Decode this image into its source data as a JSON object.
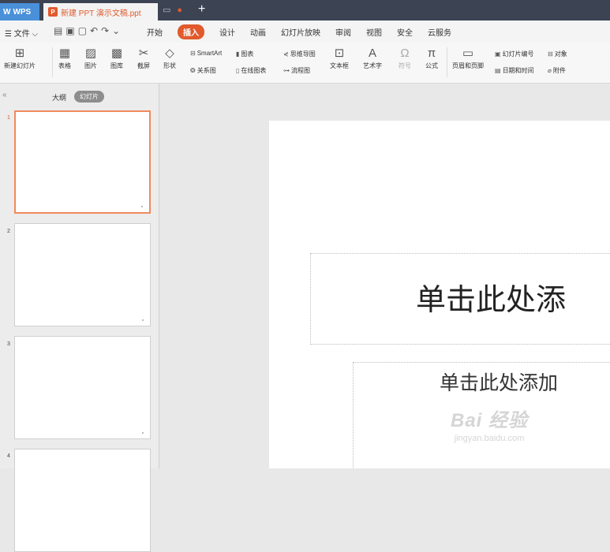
{
  "titlebar": {
    "app_tab": "WPS",
    "doc_tab": "新建 PPT 演示文稿.ppt",
    "add_tab": "+"
  },
  "menubar": {
    "file_label": "文件",
    "tabs": [
      "开始",
      "插入",
      "设计",
      "动画",
      "幻灯片放映",
      "审阅",
      "视图",
      "安全",
      "云服务"
    ],
    "active_tab": "插入"
  },
  "ribbon": {
    "new_slide": "新建幻灯片",
    "table": "表格",
    "picture": "图片",
    "gallery": "图库",
    "screenshot": "截屏",
    "shape": "形状",
    "smartart": "SmartArt",
    "relation": "关系图",
    "chart": "图表",
    "online_chart": "在线图表",
    "mindmap": "思维导图",
    "flowchart": "流程图",
    "textbox": "文本框",
    "wordart": "艺术字",
    "symbol": "符号",
    "formula": "公式",
    "header_footer": "页眉和页脚",
    "slide_number": "幻灯片编号",
    "object": "对象",
    "datetime": "日期和时间",
    "attachment": "附件"
  },
  "leftpanel": {
    "collapse": "«",
    "outline": "大纲",
    "slides": "幻灯片",
    "thumbs": [
      {
        "num": "1"
      },
      {
        "num": "2"
      },
      {
        "num": "3"
      },
      {
        "num": "4"
      }
    ]
  },
  "slide": {
    "title_placeholder": "单击此处添",
    "subtitle_placeholder": "单击此处添加"
  },
  "watermark": {
    "logo": "Bai 经验",
    "url": "jingyan.baidu.com"
  },
  "colors": {
    "accent": "#e15a2c",
    "titlebar": "#3c4454",
    "wps_tab": "#4a90d9"
  }
}
